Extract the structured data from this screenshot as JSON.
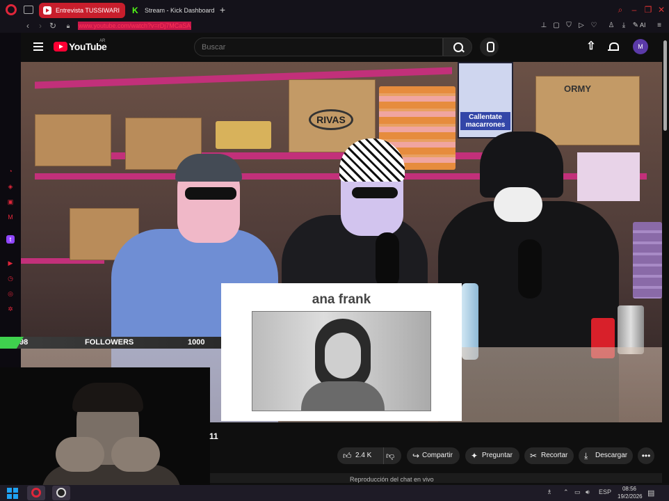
{
  "browser": {
    "tabs": [
      {
        "label": "Entrevista TUSSIWARI",
        "active": true
      },
      {
        "label": "Stream - Kick Dashboard",
        "active": false
      }
    ],
    "url": "www.youtube.com/watch?v=rDj7MCaSA",
    "toolbar_ai_label": "AI"
  },
  "youtube": {
    "logo_text": "YouTube",
    "country_code": "AR",
    "search_placeholder": "Buscar",
    "avatar_initial": "M"
  },
  "video": {
    "meme_card": {
      "title": "ana frank"
    },
    "followers_bar": {
      "prefix": "98",
      "label": "FOLLOWERS",
      "goal": "1000"
    },
    "scene_text": {
      "box_left": "RIVAS",
      "box_right": "ORMY",
      "poster": "Callentate macarrones"
    }
  },
  "below_video": {
    "title_fragment": "11",
    "actions": {
      "like_count": "2.4 K",
      "share": "Compartir",
      "ask": "Preguntar",
      "clip": "Recortar",
      "download": "Descargar"
    },
    "chat_replay": "Reproducción del chat en vivo"
  },
  "taskbar": {
    "lang": "ESP",
    "time": "08:56",
    "date": "19/2/2026"
  },
  "colors": {
    "opera_red": "#e0263a",
    "youtube_red": "#ff0033",
    "kick_green": "#53fc18",
    "url_highlight": "#c8174a"
  }
}
